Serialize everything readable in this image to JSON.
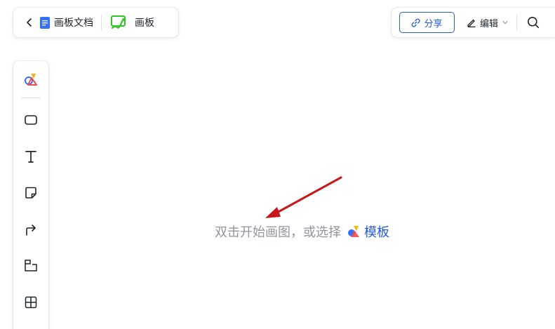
{
  "header": {
    "back_icon": "chevron-left-icon",
    "doc_icon": "document-icon",
    "doc_title": "画板文档",
    "board_icon": "whiteboard-icon",
    "board_title": "画板"
  },
  "toolbar": {
    "share_label": "分享",
    "share_icon": "link-icon",
    "edit_label": "编辑",
    "edit_icon": "pen-icon",
    "search_icon": "search-icon"
  },
  "tools": [
    {
      "name": "shapes-template",
      "icon": "shapes-icon"
    },
    {
      "name": "rectangle",
      "icon": "rectangle-icon"
    },
    {
      "name": "text",
      "icon": "text-icon"
    },
    {
      "name": "sticky-note",
      "icon": "sticky-note-icon"
    },
    {
      "name": "connector",
      "icon": "connector-icon"
    },
    {
      "name": "frame",
      "icon": "frame-icon"
    },
    {
      "name": "table",
      "icon": "table-icon"
    }
  ],
  "canvas": {
    "hint_text": "双击开始画图，或选择",
    "template_link": "模板"
  },
  "colors": {
    "accent": "#245bdb",
    "hint_gray": "#8f959e",
    "annotation_arrow": "#c8161d",
    "board_green": "#34c724"
  }
}
